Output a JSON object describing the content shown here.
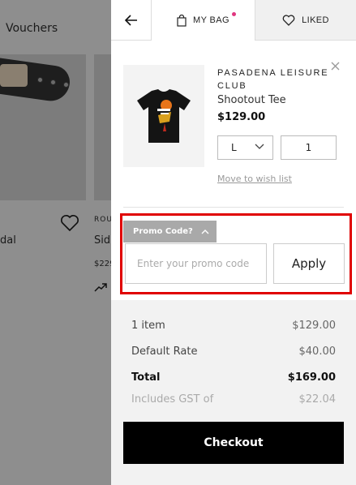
{
  "background": {
    "vouchers_label": "Vouchers",
    "product1_name_fragment": "dal",
    "product2_brand_fragment": "ROU",
    "product2_name_fragment": "Sid",
    "product2_price_fragment": "$229"
  },
  "tabs": {
    "back_icon": "arrow-left-icon",
    "bag_label": "MY BAG",
    "bag_icon": "shopping-bag-icon",
    "liked_label": "LIKED",
    "liked_icon": "heart-icon",
    "notification_color": "#e0357f"
  },
  "bag_item": {
    "brand": "PASADENA LEISURE CLUB",
    "name": "Shootout Tee",
    "price": "$129.00",
    "size": "L",
    "quantity": "1",
    "wish_link": "Move to wish list"
  },
  "promo": {
    "toggle_label": "Promo Code?",
    "input_placeholder": "Enter your promo code",
    "apply_label": "Apply",
    "highlight_color": "#e00000"
  },
  "summary": {
    "items_label": "1 item",
    "items_value": "$129.00",
    "shipping_label": "Default Rate",
    "shipping_value": "$40.00",
    "total_label": "Total",
    "total_value": "$169.00",
    "gst_label": "Includes GST of",
    "gst_value": "$22.04"
  },
  "checkout_label": "Checkout"
}
